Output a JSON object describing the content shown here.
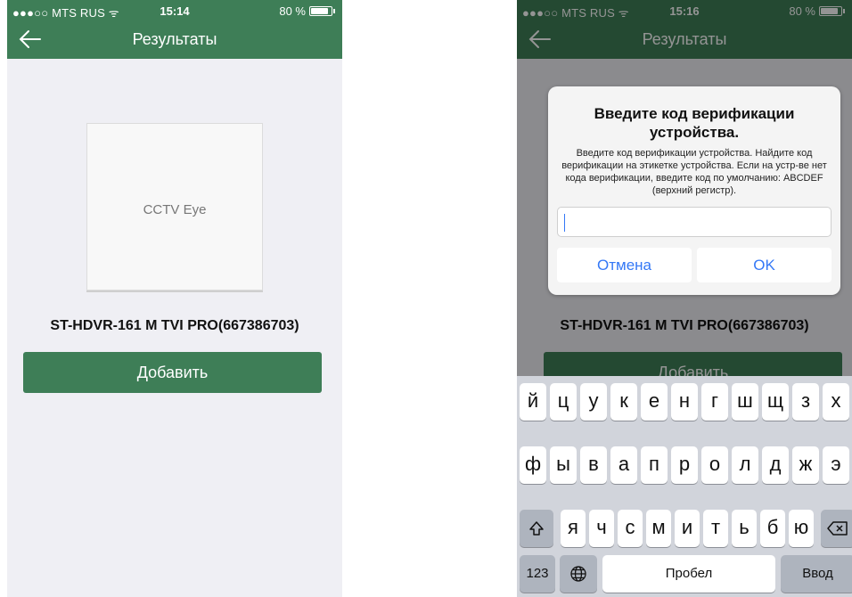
{
  "left": {
    "status": {
      "carrier": "●●●○○ MTS RUS ᯤ",
      "time": "15:14",
      "battery": "80 %"
    },
    "title": "Результаты",
    "tile_label": "CCTV Eye",
    "device_name": "ST-HDVR-161 M TVI PRO(667386703)",
    "add_button": "Добавить"
  },
  "right": {
    "status": {
      "carrier": "●●●○○ MTS RUS ᯤ",
      "time": "15:16",
      "battery": "80 %"
    },
    "title": "Результаты",
    "device_name": "ST-HDVR-161 M TVI PRO(667386703)",
    "add_button": "Добавить",
    "dialog": {
      "title": "Введите код верификации устройства.",
      "message": "Введите код верификации устройства. Найдите код верификации на этикетке устройства. Если на устр-ве нет кода верификации, введите код по умолчанию: ABCDEF (верхний регистр).",
      "input_value": "",
      "cancel": "Отмена",
      "ok": "OK"
    },
    "keyboard": {
      "row1": [
        "й",
        "ц",
        "у",
        "к",
        "е",
        "н",
        "г",
        "ш",
        "щ",
        "з",
        "х"
      ],
      "row2": [
        "ф",
        "ы",
        "в",
        "а",
        "п",
        "р",
        "о",
        "л",
        "д",
        "ж",
        "э"
      ],
      "row3": [
        "я",
        "ч",
        "с",
        "м",
        "и",
        "т",
        "ь",
        "б",
        "ю"
      ],
      "shift_icon": "shift-icon",
      "backspace_icon": "backspace-icon",
      "globe_icon": "globe-icon",
      "numbers": "123",
      "space": "Пробел",
      "return": "Ввод"
    }
  },
  "colors": {
    "accent": "#3e7e57",
    "link": "#3478f6"
  }
}
